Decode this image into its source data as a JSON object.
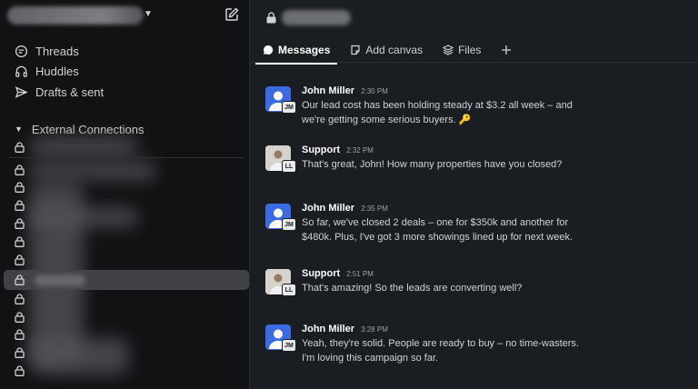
{
  "sidebar": {
    "nav": [
      {
        "label": "Threads",
        "icon": "threads-icon"
      },
      {
        "label": "Huddles",
        "icon": "headphones-icon"
      },
      {
        "label": "Drafts & sent",
        "icon": "send-icon"
      }
    ],
    "section_title": "External Connections",
    "active_channel_index": 7
  },
  "channel": {
    "tabs": [
      {
        "label": "Messages",
        "icon": "message-icon",
        "active": true
      },
      {
        "label": "Add canvas",
        "icon": "canvas-icon",
        "active": false
      },
      {
        "label": "Files",
        "icon": "files-icon",
        "active": false
      }
    ]
  },
  "messages": [
    {
      "author": "John Miller",
      "time": "2:30 PM",
      "text": "Our lead cost has been holding steady at $3.2 all week – and we're getting some serious buyers. 🔑",
      "avatar": "blue",
      "badge": "JM"
    },
    {
      "author": "Support",
      "time": "2:32 PM",
      "text": "That's great, John! How many properties have you closed?",
      "avatar": "photo",
      "badge": "LL"
    },
    {
      "author": "John Miller",
      "time": "2:35 PM",
      "text": "So far, we've closed 2 deals – one for $350k and another for $480k. Plus, I've got 3 more showings lined up for next week.",
      "avatar": "blue",
      "badge": "JM"
    },
    {
      "author": "Support",
      "time": "2:51 PM",
      "text": "That's amazing! So the leads are converting well?",
      "avatar": "photo",
      "badge": "LL"
    },
    {
      "author": "John Miller",
      "time": "3:28 PM",
      "text": "Yeah, they're solid. People are ready to buy – no time-wasters. I'm loving this campaign so far.",
      "avatar": "blue",
      "badge": "JM"
    }
  ],
  "colors": {
    "sidebar_bg": "#111214",
    "main_bg": "#1a1d21",
    "avatar_blue": "#3b6be3",
    "active_row": "#414245"
  }
}
